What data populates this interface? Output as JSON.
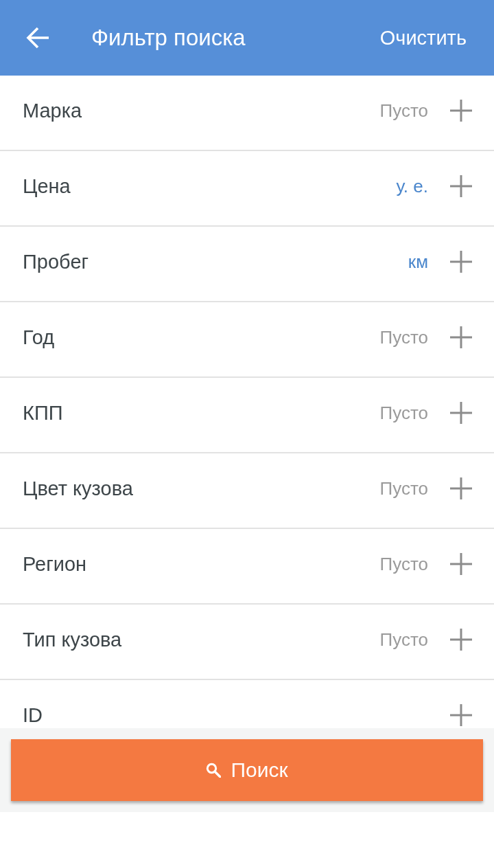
{
  "app_bar": {
    "title": "Фильтр поиска",
    "action": "Очистить"
  },
  "filters": [
    {
      "label": "Марка",
      "value": "Пусто",
      "kind": "empty"
    },
    {
      "label": "Цена",
      "value": "у. е.",
      "kind": "unit"
    },
    {
      "label": "Пробег",
      "value": "км",
      "kind": "unit"
    },
    {
      "label": "Год",
      "value": "Пусто",
      "kind": "empty"
    },
    {
      "label": "КПП",
      "value": "Пусто",
      "kind": "empty"
    },
    {
      "label": "Цвет кузова",
      "value": "Пусто",
      "kind": "empty"
    },
    {
      "label": "Регион",
      "value": "Пусто",
      "kind": "empty"
    },
    {
      "label": "Тип кузова",
      "value": "Пусто",
      "kind": "empty"
    },
    {
      "label": "ID",
      "kind": "none"
    }
  ],
  "search_button": {
    "label": "Поиск"
  }
}
